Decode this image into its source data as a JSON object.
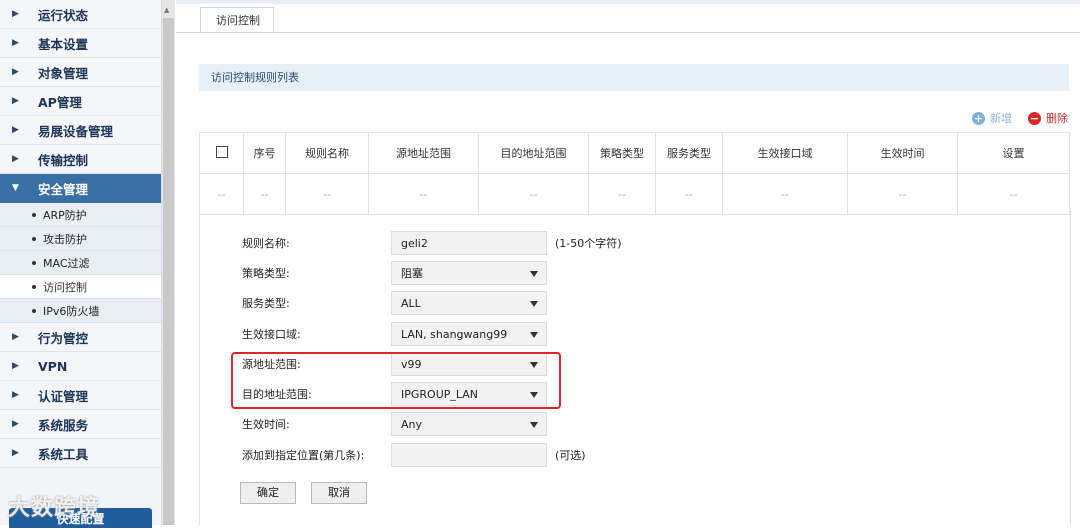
{
  "sidebar": {
    "items_top": [
      {
        "label": "运行状态"
      },
      {
        "label": "基本设置"
      },
      {
        "label": "对象管理"
      },
      {
        "label": "AP管理"
      },
      {
        "label": "易展设备管理"
      },
      {
        "label": "传输控制"
      }
    ],
    "active": {
      "label": "安全管理"
    },
    "sub_items": [
      {
        "label": "ARP防护"
      },
      {
        "label": "攻击防护"
      },
      {
        "label": "MAC过滤"
      },
      {
        "label": "访问控制"
      },
      {
        "label": "IPv6防火墙"
      }
    ],
    "items_bottom": [
      {
        "label": "行为管控"
      },
      {
        "label": "VPN"
      },
      {
        "label": "认证管理"
      },
      {
        "label": "系统服务"
      },
      {
        "label": "系统工具"
      }
    ],
    "quick_config": "快速配置",
    "watermark": "大数跨境"
  },
  "tab": {
    "label": "访问控制"
  },
  "panel": {
    "title": "访问控制规则列表"
  },
  "toolbar": {
    "add_label": "新增",
    "delete_label": "删除"
  },
  "table": {
    "headers": [
      "序号",
      "规则名称",
      "源地址范围",
      "目的地址范围",
      "策略类型",
      "服务类型",
      "生效接口域",
      "生效时间",
      "设置"
    ],
    "empty_cell": "--"
  },
  "form": {
    "rule_name": {
      "label": "规则名称:",
      "value": "geli2",
      "hint": "(1-50个字符)"
    },
    "policy_type": {
      "label": "策略类型:",
      "value": "阻塞"
    },
    "service_type": {
      "label": "服务类型:",
      "value": "ALL"
    },
    "interface": {
      "label": "生效接口域:",
      "value": "LAN, shangwang99"
    },
    "src_range": {
      "label": "源地址范围:",
      "value": "v99"
    },
    "dst_range": {
      "label": "目的地址范围:",
      "value": "IPGROUP_LAN"
    },
    "time": {
      "label": "生效时间:",
      "value": "Any"
    },
    "position": {
      "label": "添加到指定位置(第几条):",
      "value": "",
      "hint": "(可选)"
    },
    "confirm": "确定",
    "cancel": "取消"
  }
}
